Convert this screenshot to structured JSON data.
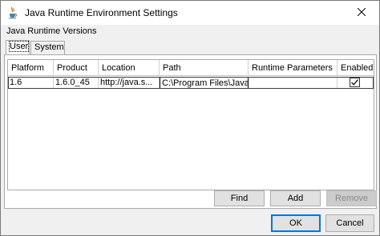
{
  "window": {
    "title": "Java Runtime Environment Settings"
  },
  "section_label": "Java Runtime Versions",
  "tabs": [
    {
      "label": "User",
      "active": true
    },
    {
      "label": "System",
      "active": false
    }
  ],
  "table": {
    "columns": [
      "Platform",
      "Product",
      "Location",
      "Path",
      "Runtime Parameters",
      "Enabled"
    ],
    "rows": [
      {
        "platform": "1.6",
        "product": "1.6.0_45",
        "location": "http://java.s...",
        "path": "C:\\Program Files\\Java...",
        "runtime_parameters": "",
        "enabled": true
      }
    ]
  },
  "panel_buttons": {
    "find": "Find",
    "add": "Add",
    "remove": "Remove"
  },
  "dialog_buttons": {
    "ok": "OK",
    "cancel": "Cancel"
  },
  "icons": {
    "app": "java-cup-icon",
    "close": "close-icon",
    "check": "checkmark-icon"
  },
  "colors": {
    "titlebar_bg": "#ffffff",
    "window_bg": "#f0f0f0",
    "default_button_border": "#0078d7",
    "java_red": "#e76f00",
    "java_blue": "#5382a1"
  }
}
